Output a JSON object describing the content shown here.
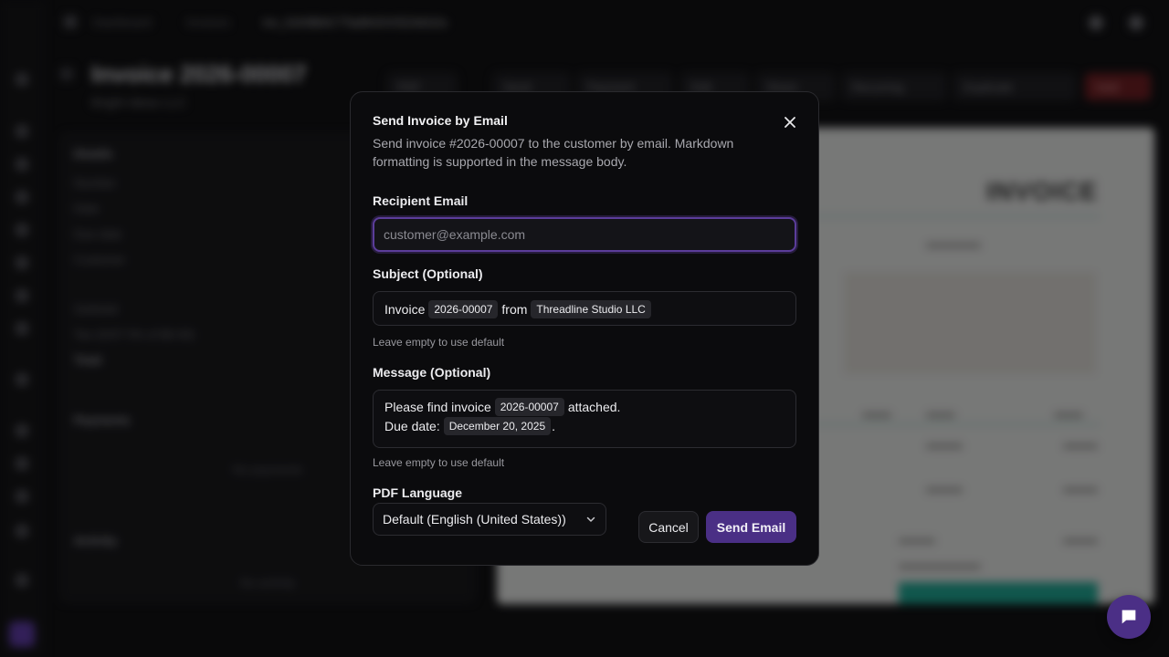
{
  "background": {
    "breadcrumb": [
      "Dashboard",
      "Invoices",
      "inv_01K8BAC7Tad9n5XX5Z4d1Gs"
    ],
    "page_title": "Invoice 2026-00007",
    "page_subtitle": "Bright Ideas LLC",
    "actions": [
      "PDF",
      "Send",
      "Payment",
      "Edit",
      "Share",
      "Recurring",
      "Duplicate",
      "Void"
    ],
    "details": {
      "heading": "Details",
      "rows": [
        "Number",
        "Date",
        "Due date",
        "Customer",
        "Subtotal",
        "Tax (GST 5% of $0.00)",
        "Total"
      ]
    },
    "payments": {
      "heading": "Payments",
      "empty": "No payments"
    },
    "activity": {
      "heading": "Activity",
      "empty": "No activity"
    },
    "preview_title": "INVOICE"
  },
  "modal": {
    "title": "Send Invoice by Email",
    "description": "Send invoice #2026-00007 to the customer by email. Markdown formatting is supported in the message body.",
    "recipient": {
      "label": "Recipient Email",
      "placeholder": "customer@example.com",
      "value": ""
    },
    "subject": {
      "label": "Subject (Optional)",
      "prefix": "Invoice",
      "chip1": "2026-00007",
      "middle": "from",
      "chip2": "Threadline Studio LLC",
      "hint": "Leave empty to use default"
    },
    "message": {
      "label": "Message (Optional)",
      "line1_prefix": "Please find invoice",
      "line1_chip": "2026-00007",
      "line1_suffix": "attached.",
      "line2_prefix": "Due date:",
      "line2_chip": "December 20, 2025",
      "line2_suffix": ".",
      "hint": "Leave empty to use default"
    },
    "language": {
      "label": "PDF Language",
      "selected": "Default (English (United States))"
    },
    "cancel_label": "Cancel",
    "send_label": "Send Email"
  },
  "colors": {
    "accent": "#4a2f85",
    "focus_ring": "#5b3d9a",
    "modal_bg": "#0b0b0d"
  }
}
